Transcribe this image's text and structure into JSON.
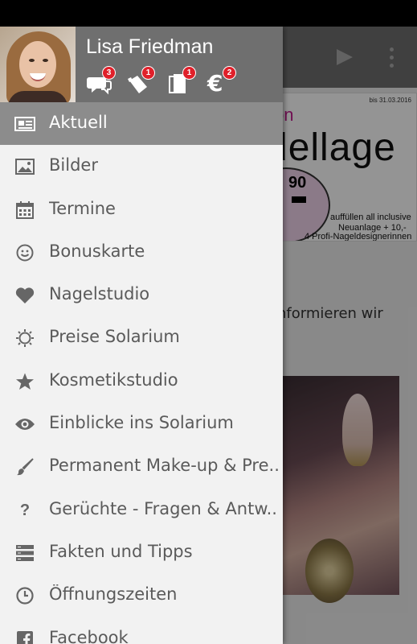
{
  "app": {
    "flyer": {
      "date": "bis 31.03.2016",
      "subtitle": "on",
      "title": "dellage",
      "price": "90",
      "line1": "auffüllen all inclusive",
      "line2": "Neuanlage + 10,-",
      "line3": "4 Profi-Nageldesignerinnen"
    },
    "body_text": "informieren wir"
  },
  "drawer": {
    "user_name": "Lisa Friedman",
    "header_icons": [
      {
        "icon": "chat-bubbles-icon",
        "badge": "3"
      },
      {
        "icon": "coupon-tag-icon",
        "badge": "1"
      },
      {
        "icon": "documents-icon",
        "badge": "1"
      },
      {
        "icon": "euro-icon",
        "badge": "2"
      }
    ],
    "items": [
      {
        "label": "Aktuell",
        "icon": "newspaper-icon",
        "active": true
      },
      {
        "label": "Bilder",
        "icon": "image-icon"
      },
      {
        "label": "Termine",
        "icon": "calendar-icon"
      },
      {
        "label": "Bonuskarte",
        "icon": "smiley-icon"
      },
      {
        "label": "Nagelstudio",
        "icon": "heart-icon"
      },
      {
        "label": "Preise Solarium",
        "icon": "sun-icon"
      },
      {
        "label": "Kosmetikstudio",
        "icon": "star-icon"
      },
      {
        "label": "Einblicke ins Solarium",
        "icon": "eye-icon"
      },
      {
        "label": "Permanent Make-up & Pre...",
        "icon": "brush-icon"
      },
      {
        "label": "Gerüchte - Fragen & Antw...",
        "icon": "question-icon"
      },
      {
        "label": "Fakten und Tipps",
        "icon": "list-icon"
      },
      {
        "label": "Öffnungszeiten",
        "icon": "clock-icon"
      },
      {
        "label": "Facebook",
        "icon": "facebook-icon"
      }
    ]
  },
  "colors": {
    "header_bg": "#6f6f6f",
    "active_item_bg": "#8c8c8c",
    "badge_red": "#e0202a",
    "flyer_magenta": "#c21b8e"
  }
}
